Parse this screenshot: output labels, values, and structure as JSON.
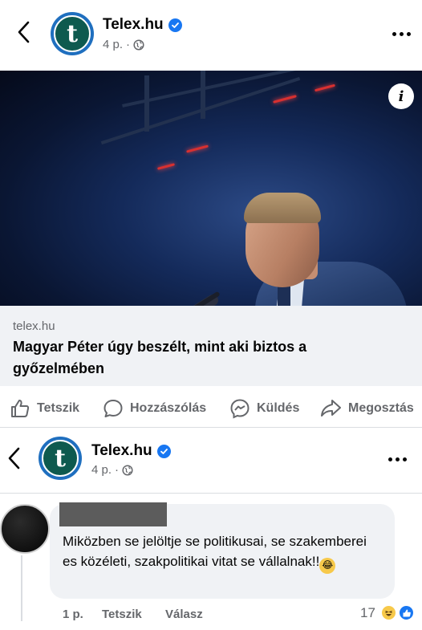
{
  "post": {
    "page_name": "Telex.hu",
    "avatar_letter": "t",
    "time": "4 p.",
    "dot": "·"
  },
  "link": {
    "domain": "telex.hu",
    "title": "Magyar Péter úgy beszélt, mint aki biztos a győzelmében",
    "info_label": "i"
  },
  "actions": {
    "like": "Tetszik",
    "comment": "Hozzászólás",
    "send": "Küldés",
    "share": "Megosztás"
  },
  "sticky_header": {
    "page_name": "Telex.hu",
    "avatar_letter": "t",
    "time": "4 p.",
    "dot": "·"
  },
  "comment": {
    "text": "Miközben se jelöltje se politikusai, se szakemberei es közéleti, szakpolitikai vitat se vállalnak!!",
    "emoji": "😂",
    "time": "1 p.",
    "like": "Tetszik",
    "reply": "Válasz",
    "reaction_count": "17"
  },
  "colors": {
    "brand_blue": "#1877f2",
    "avatar_green": "#0e5a4f",
    "secondary_text": "#65676b"
  },
  "icons": [
    "back-chevron-icon",
    "verified-badge-icon",
    "globe-icon",
    "more-icon",
    "info-icon",
    "like-icon",
    "comment-icon",
    "messenger-icon",
    "share-icon",
    "haha-reaction-icon",
    "like-reaction-icon"
  ]
}
